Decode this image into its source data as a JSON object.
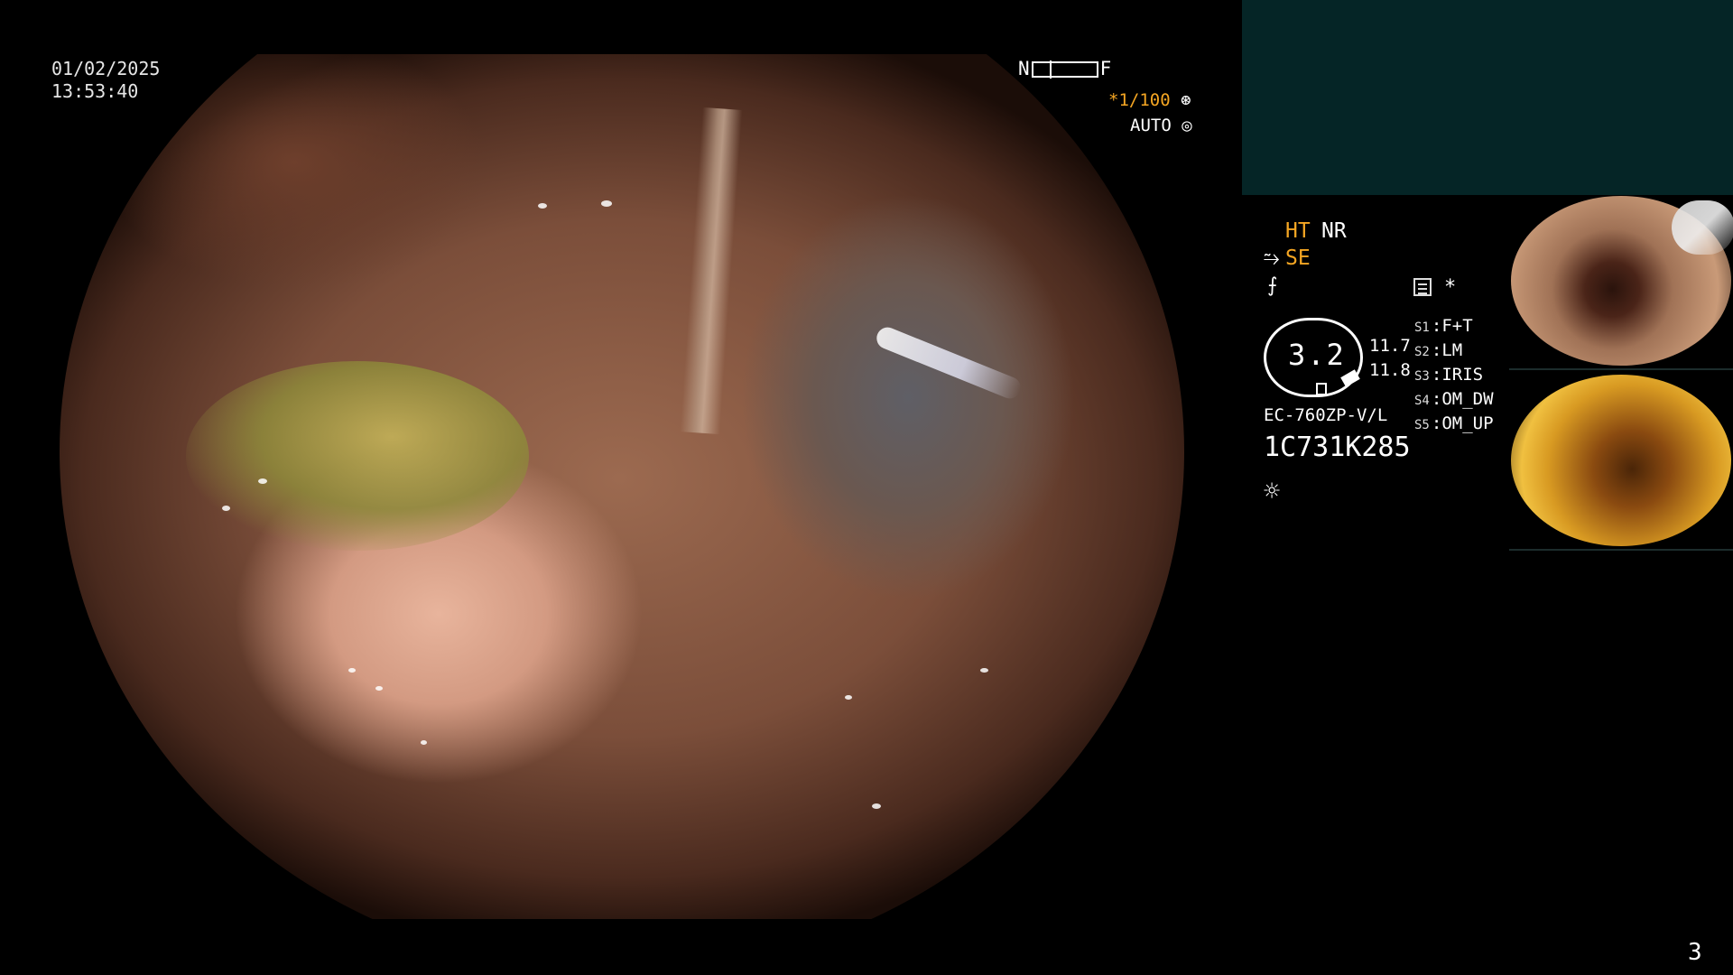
{
  "datetime": {
    "date": "01/02/2025",
    "time": "13:53:40"
  },
  "top_indicators": {
    "near_label": "N",
    "far_label": "F",
    "shutter_star": "*",
    "shutter_speed": "1/100",
    "shutter_icon": "aperture-icon",
    "auto_label": "AUTO",
    "auto_icon": "iris-icon"
  },
  "modes": {
    "ht": "HT",
    "nr": "NR",
    "se_icon": "scope-tip-icon",
    "se": "SE",
    "structure_icon": "structure-enhance-icon",
    "star": "*"
  },
  "zoom": {
    "value": "3.2",
    "val1": "11.7",
    "val2": "11.8"
  },
  "scope": {
    "model": "EC-760ZP-V/L",
    "serial": "1C731K285"
  },
  "switches": [
    {
      "key": "S1",
      "value": "F+T"
    },
    {
      "key": "S2",
      "value": "LM"
    },
    {
      "key": "S3",
      "value": "IRIS"
    },
    {
      "key": "S4",
      "value": "OM_DW"
    },
    {
      "key": "S5",
      "value": "OM_UP"
    }
  ],
  "light_icon": "light-source-icon",
  "page_number": "3",
  "colors": {
    "accent_orange": "#f5a623",
    "panel_teal": "#052526"
  }
}
